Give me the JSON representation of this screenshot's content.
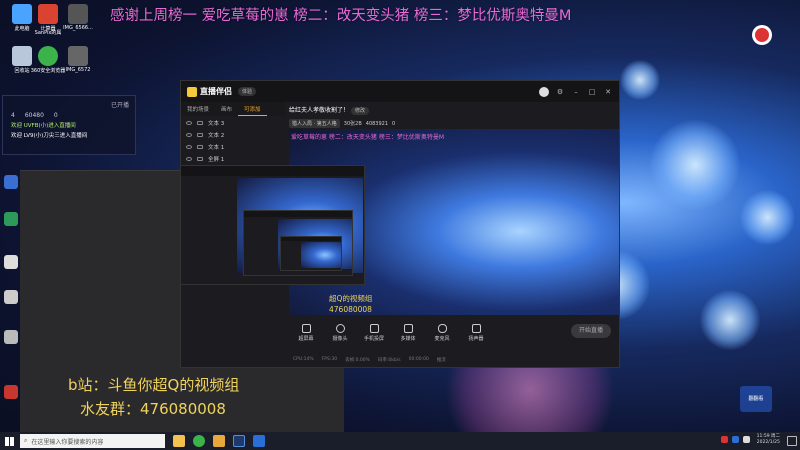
{
  "desktop": {
    "icons": [
      {
        "label": "此电脑",
        "color": "#4aa3ff"
      },
      {
        "label": "计算器",
        "color": "#d9432f"
      },
      {
        "label": "SanPix的属",
        "color": "#888888"
      },
      {
        "label": "IMG_6566...",
        "color": "#555555"
      },
      {
        "label": "回收站",
        "color": "#b8c7d9"
      },
      {
        "label": "360安全浏览器",
        "color": "#3bb34a"
      },
      {
        "label": "IMG_6572",
        "color": "#666666"
      }
    ],
    "marquee": "感谢上周榜一  爱吃草莓的崽 榜二：改天变头猪 榜三：梦比优斯奥特曼M"
  },
  "chat_overlay": {
    "status": "已开播",
    "stats": [
      "4",
      "60480",
      "0"
    ],
    "lines": [
      {
        "text": "欢迎 UVFB(小)进入直播间",
        "color": "#b6f06a"
      },
      {
        "text": "欢迎 LV9(小)刀尖三进入直播间",
        "color": "#ffffff"
      }
    ]
  },
  "overlay_text": {
    "line1": "b站：斗鱼你超Q的视频组",
    "line2": "水友群：476080008"
  },
  "app": {
    "name": "直播伴侣",
    "badge": "体验",
    "tabs": [
      {
        "label": "我的场景",
        "active": false
      },
      {
        "label": "画布",
        "active": false
      },
      {
        "label": "可添加",
        "active": true
      }
    ],
    "layers": [
      "文本 3",
      "文本 2",
      "文本 1",
      "全屏 1"
    ],
    "room": {
      "name": "给红夫人孝敬收割了！",
      "edit": "修改",
      "tag1": "猎人入局 · 第五人格",
      "tag2": "30张2B",
      "viewers": "4083921",
      "count": "0"
    },
    "preview_marquee": "爱吃草莓的崽 榜二：改天变头猪 榜三：梦比优斯奥特曼M",
    "preview_overlay1": "超Q的视频组",
    "preview_overlay2": "476080008",
    "tools": [
      "超屏幕",
      "摄像头",
      "手机投屏",
      "多媒体",
      "麦克风",
      "扬声器"
    ],
    "go_live": "开始直播",
    "status_items": [
      "CPU:14%",
      "FPS:30",
      "丢帧:0.00%",
      "码率:0kb/s",
      "00:00:00",
      "推流"
    ]
  },
  "taskbar": {
    "search_placeholder": "在这里输入你要搜索的内容",
    "time": "11:59 周二",
    "date": "2022/1/25"
  },
  "corner_badge": "翻翻看"
}
